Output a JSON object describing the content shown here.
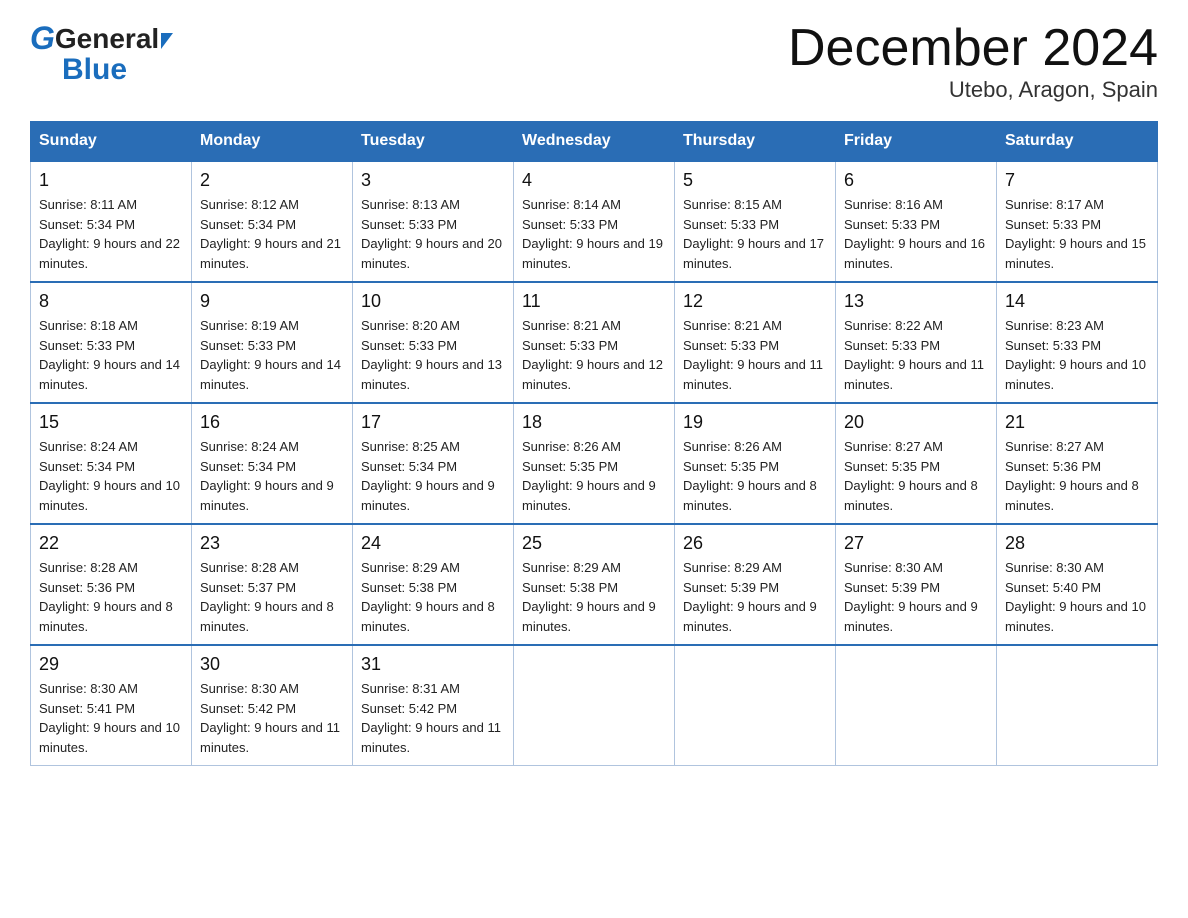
{
  "header": {
    "logo_general": "General",
    "logo_blue": "Blue",
    "title": "December 2024",
    "subtitle": "Utebo, Aragon, Spain"
  },
  "days_of_week": [
    "Sunday",
    "Monday",
    "Tuesday",
    "Wednesday",
    "Thursday",
    "Friday",
    "Saturday"
  ],
  "weeks": [
    [
      {
        "day": "1",
        "sunrise": "8:11 AM",
        "sunset": "5:34 PM",
        "daylight": "9 hours and 22 minutes."
      },
      {
        "day": "2",
        "sunrise": "8:12 AM",
        "sunset": "5:34 PM",
        "daylight": "9 hours and 21 minutes."
      },
      {
        "day": "3",
        "sunrise": "8:13 AM",
        "sunset": "5:33 PM",
        "daylight": "9 hours and 20 minutes."
      },
      {
        "day": "4",
        "sunrise": "8:14 AM",
        "sunset": "5:33 PM",
        "daylight": "9 hours and 19 minutes."
      },
      {
        "day": "5",
        "sunrise": "8:15 AM",
        "sunset": "5:33 PM",
        "daylight": "9 hours and 17 minutes."
      },
      {
        "day": "6",
        "sunrise": "8:16 AM",
        "sunset": "5:33 PM",
        "daylight": "9 hours and 16 minutes."
      },
      {
        "day": "7",
        "sunrise": "8:17 AM",
        "sunset": "5:33 PM",
        "daylight": "9 hours and 15 minutes."
      }
    ],
    [
      {
        "day": "8",
        "sunrise": "8:18 AM",
        "sunset": "5:33 PM",
        "daylight": "9 hours and 14 minutes."
      },
      {
        "day": "9",
        "sunrise": "8:19 AM",
        "sunset": "5:33 PM",
        "daylight": "9 hours and 14 minutes."
      },
      {
        "day": "10",
        "sunrise": "8:20 AM",
        "sunset": "5:33 PM",
        "daylight": "9 hours and 13 minutes."
      },
      {
        "day": "11",
        "sunrise": "8:21 AM",
        "sunset": "5:33 PM",
        "daylight": "9 hours and 12 minutes."
      },
      {
        "day": "12",
        "sunrise": "8:21 AM",
        "sunset": "5:33 PM",
        "daylight": "9 hours and 11 minutes."
      },
      {
        "day": "13",
        "sunrise": "8:22 AM",
        "sunset": "5:33 PM",
        "daylight": "9 hours and 11 minutes."
      },
      {
        "day": "14",
        "sunrise": "8:23 AM",
        "sunset": "5:33 PM",
        "daylight": "9 hours and 10 minutes."
      }
    ],
    [
      {
        "day": "15",
        "sunrise": "8:24 AM",
        "sunset": "5:34 PM",
        "daylight": "9 hours and 10 minutes."
      },
      {
        "day": "16",
        "sunrise": "8:24 AM",
        "sunset": "5:34 PM",
        "daylight": "9 hours and 9 minutes."
      },
      {
        "day": "17",
        "sunrise": "8:25 AM",
        "sunset": "5:34 PM",
        "daylight": "9 hours and 9 minutes."
      },
      {
        "day": "18",
        "sunrise": "8:26 AM",
        "sunset": "5:35 PM",
        "daylight": "9 hours and 9 minutes."
      },
      {
        "day": "19",
        "sunrise": "8:26 AM",
        "sunset": "5:35 PM",
        "daylight": "9 hours and 8 minutes."
      },
      {
        "day": "20",
        "sunrise": "8:27 AM",
        "sunset": "5:35 PM",
        "daylight": "9 hours and 8 minutes."
      },
      {
        "day": "21",
        "sunrise": "8:27 AM",
        "sunset": "5:36 PM",
        "daylight": "9 hours and 8 minutes."
      }
    ],
    [
      {
        "day": "22",
        "sunrise": "8:28 AM",
        "sunset": "5:36 PM",
        "daylight": "9 hours and 8 minutes."
      },
      {
        "day": "23",
        "sunrise": "8:28 AM",
        "sunset": "5:37 PM",
        "daylight": "9 hours and 8 minutes."
      },
      {
        "day": "24",
        "sunrise": "8:29 AM",
        "sunset": "5:38 PM",
        "daylight": "9 hours and 8 minutes."
      },
      {
        "day": "25",
        "sunrise": "8:29 AM",
        "sunset": "5:38 PM",
        "daylight": "9 hours and 9 minutes."
      },
      {
        "day": "26",
        "sunrise": "8:29 AM",
        "sunset": "5:39 PM",
        "daylight": "9 hours and 9 minutes."
      },
      {
        "day": "27",
        "sunrise": "8:30 AM",
        "sunset": "5:39 PM",
        "daylight": "9 hours and 9 minutes."
      },
      {
        "day": "28",
        "sunrise": "8:30 AM",
        "sunset": "5:40 PM",
        "daylight": "9 hours and 10 minutes."
      }
    ],
    [
      {
        "day": "29",
        "sunrise": "8:30 AM",
        "sunset": "5:41 PM",
        "daylight": "9 hours and 10 minutes."
      },
      {
        "day": "30",
        "sunrise": "8:30 AM",
        "sunset": "5:42 PM",
        "daylight": "9 hours and 11 minutes."
      },
      {
        "day": "31",
        "sunrise": "8:31 AM",
        "sunset": "5:42 PM",
        "daylight": "9 hours and 11 minutes."
      },
      null,
      null,
      null,
      null
    ]
  ],
  "labels": {
    "sunrise": "Sunrise:",
    "sunset": "Sunset:",
    "daylight": "Daylight:"
  }
}
